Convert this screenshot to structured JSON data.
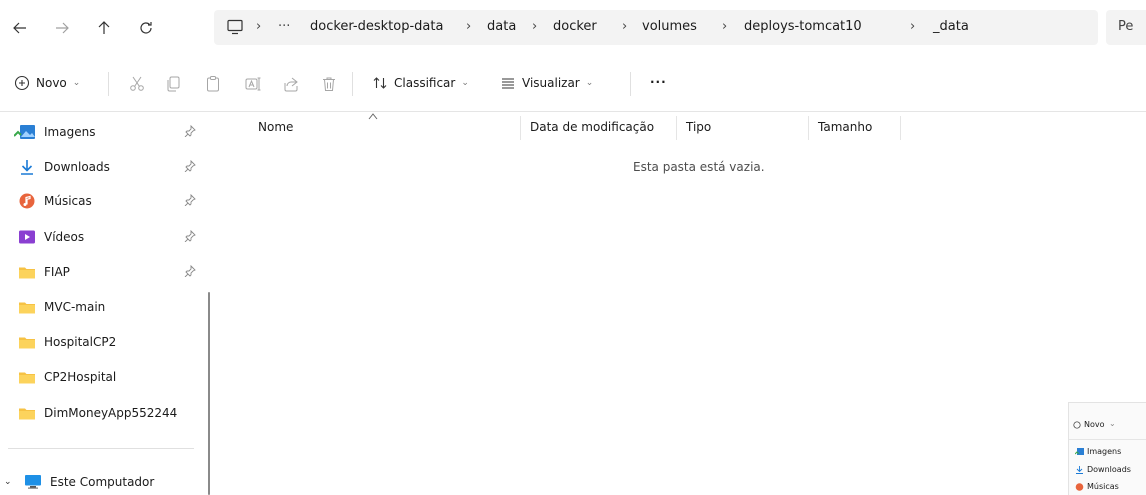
{
  "address_bar": {
    "more_label": "···",
    "crumbs": [
      "docker-desktop-data",
      "data",
      "docker",
      "volumes",
      "deploys-tomcat10",
      "_data"
    ],
    "search_placeholder": "Pe"
  },
  "toolbar": {
    "new_label": "Novo",
    "sort_label": "Classificar",
    "view_label": "Visualizar",
    "more_label": "···"
  },
  "sidebar": {
    "items": [
      {
        "label": "Imagens",
        "icon": "images-icon",
        "pinned": true
      },
      {
        "label": "Downloads",
        "icon": "download-icon",
        "pinned": true
      },
      {
        "label": "Músicas",
        "icon": "music-icon",
        "pinned": true
      },
      {
        "label": "Vídeos",
        "icon": "videos-icon",
        "pinned": true
      },
      {
        "label": "FIAP",
        "icon": "folder-icon",
        "pinned": true
      },
      {
        "label": "MVC-main",
        "icon": "folder-icon",
        "pinned": false
      },
      {
        "label": "HospitalCP2",
        "icon": "folder-icon",
        "pinned": false
      },
      {
        "label": "CP2Hospital",
        "icon": "folder-icon",
        "pinned": false
      },
      {
        "label": "DimMoneyApp552244",
        "icon": "folder-icon",
        "pinned": false
      }
    ],
    "computer_label": "Este Computador"
  },
  "main": {
    "columns": [
      "Nome",
      "Data de modificação",
      "Tipo",
      "Tamanho"
    ],
    "empty_message": "Esta pasta está vazia."
  },
  "thumbnail": {
    "new_label": "Novo",
    "items": [
      "Imagens",
      "Downloads",
      "Músicas"
    ]
  },
  "colors": {
    "folder": "#f6c244",
    "accent": "#0067c0",
    "music": "#e8643c",
    "video": "#8a3fd1"
  }
}
